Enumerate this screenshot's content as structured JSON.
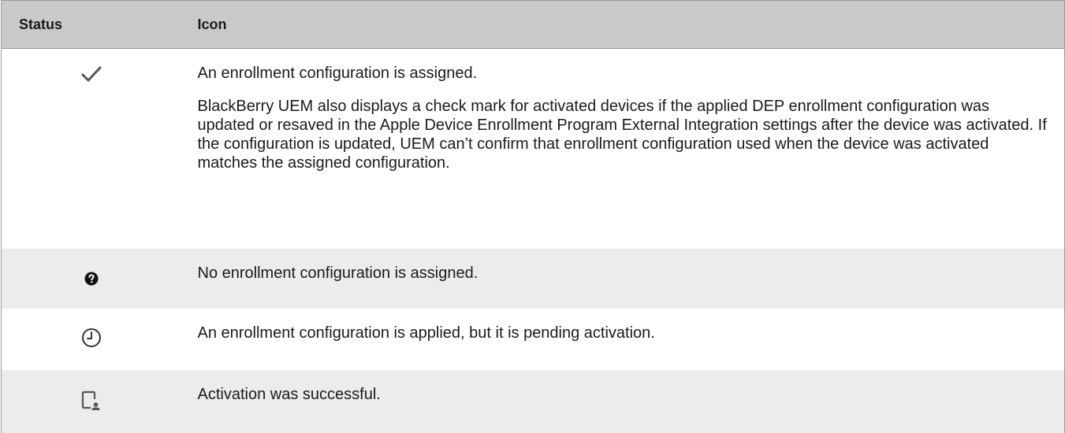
{
  "table": {
    "headers": {
      "status": "Status",
      "icon": "Icon"
    },
    "rows": [
      {
        "icon": "check-mark-icon",
        "paragraphs": [
          "An enrollment configuration is assigned.",
          "BlackBerry UEM also displays a check mark for activated devices if the applied DEP enrollment configuration was updated or resaved in the Apple Device Enrollment Program External Integration settings after the device was activated. If the configuration is updated, UEM can’t confirm that enrollment configuration used when the device was activated matches the assigned configuration."
        ]
      },
      {
        "icon": "question-mark-circle-icon",
        "paragraphs": [
          "No enrollment configuration is assigned."
        ]
      },
      {
        "icon": "clock-icon",
        "paragraphs": [
          "An enrollment configuration is applied, but it is pending activation."
        ]
      },
      {
        "icon": "device-user-icon",
        "paragraphs": [
          "Activation was successful."
        ]
      }
    ]
  },
  "colors": {
    "header_bg": "#c9c9c9",
    "shaded_row_bg": "#ececec",
    "border": "#9a9a9a",
    "icon_color": "#555555"
  }
}
